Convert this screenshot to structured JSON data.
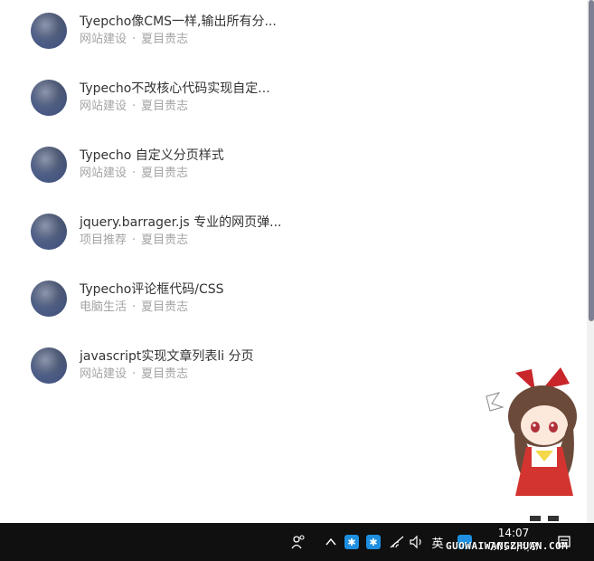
{
  "posts": [
    {
      "title": "Tyepcho像CMS一样,输出所有分...",
      "category": "网站建设",
      "author": "夏目贵志"
    },
    {
      "title": "Typecho不改核心代码实现自定...",
      "category": "网站建设",
      "author": "夏目贵志"
    },
    {
      "title": "Typecho 自定义分页样式",
      "category": "网站建设",
      "author": "夏目贵志"
    },
    {
      "title": "jquery.barrager.js 专业的网页弹...",
      "category": "项目推荐",
      "author": "夏目贵志"
    },
    {
      "title": "Typecho评论框代码/CSS",
      "category": "电脑生活",
      "author": "夏目贵志"
    },
    {
      "title": "javascript实现文章列表li 分页",
      "category": "网站建设",
      "author": "夏目贵志"
    }
  ],
  "separator": "·",
  "taskbar": {
    "icons": [
      "people-icon",
      "chevron-up-icon",
      "tray-app-icon",
      "tray-app-icon",
      "wifi-icon",
      "volume-icon",
      "ime-icon",
      "notification-icon"
    ],
    "ime_label": "英",
    "time": "14:07",
    "date": "2018/4/2",
    "watermark": "GUOWAIWANGZHUAN.COM"
  },
  "colors": {
    "title": "#333333",
    "meta": "#a4a4a4",
    "taskbar": "#101010",
    "tray_blue": "#1e8fe0"
  }
}
